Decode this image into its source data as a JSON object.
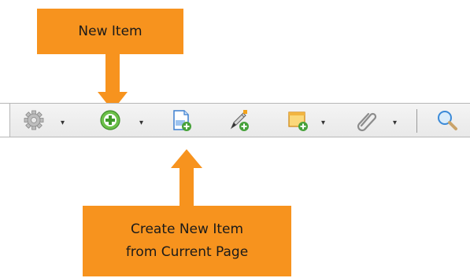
{
  "callouts": {
    "new_item": "New Item",
    "create_from_page_line1": "Create New Item",
    "create_from_page_line2": "from Current Page"
  },
  "toolbar": {
    "buttons": [
      {
        "icon": "gear-icon",
        "has_dropdown": true
      },
      {
        "icon": "add-circle-icon",
        "has_dropdown": true
      },
      {
        "icon": "new-page-icon",
        "has_dropdown": false
      },
      {
        "icon": "pen-add-icon",
        "has_dropdown": false
      },
      {
        "icon": "note-add-icon",
        "has_dropdown": true
      },
      {
        "icon": "paperclip-icon",
        "has_dropdown": true
      },
      {
        "icon": "search-icon",
        "has_dropdown": false
      }
    ],
    "dropdown_glyph": "▾"
  },
  "colors": {
    "callout": "#f7931e",
    "toolbar_border": "#b7b7b7"
  }
}
